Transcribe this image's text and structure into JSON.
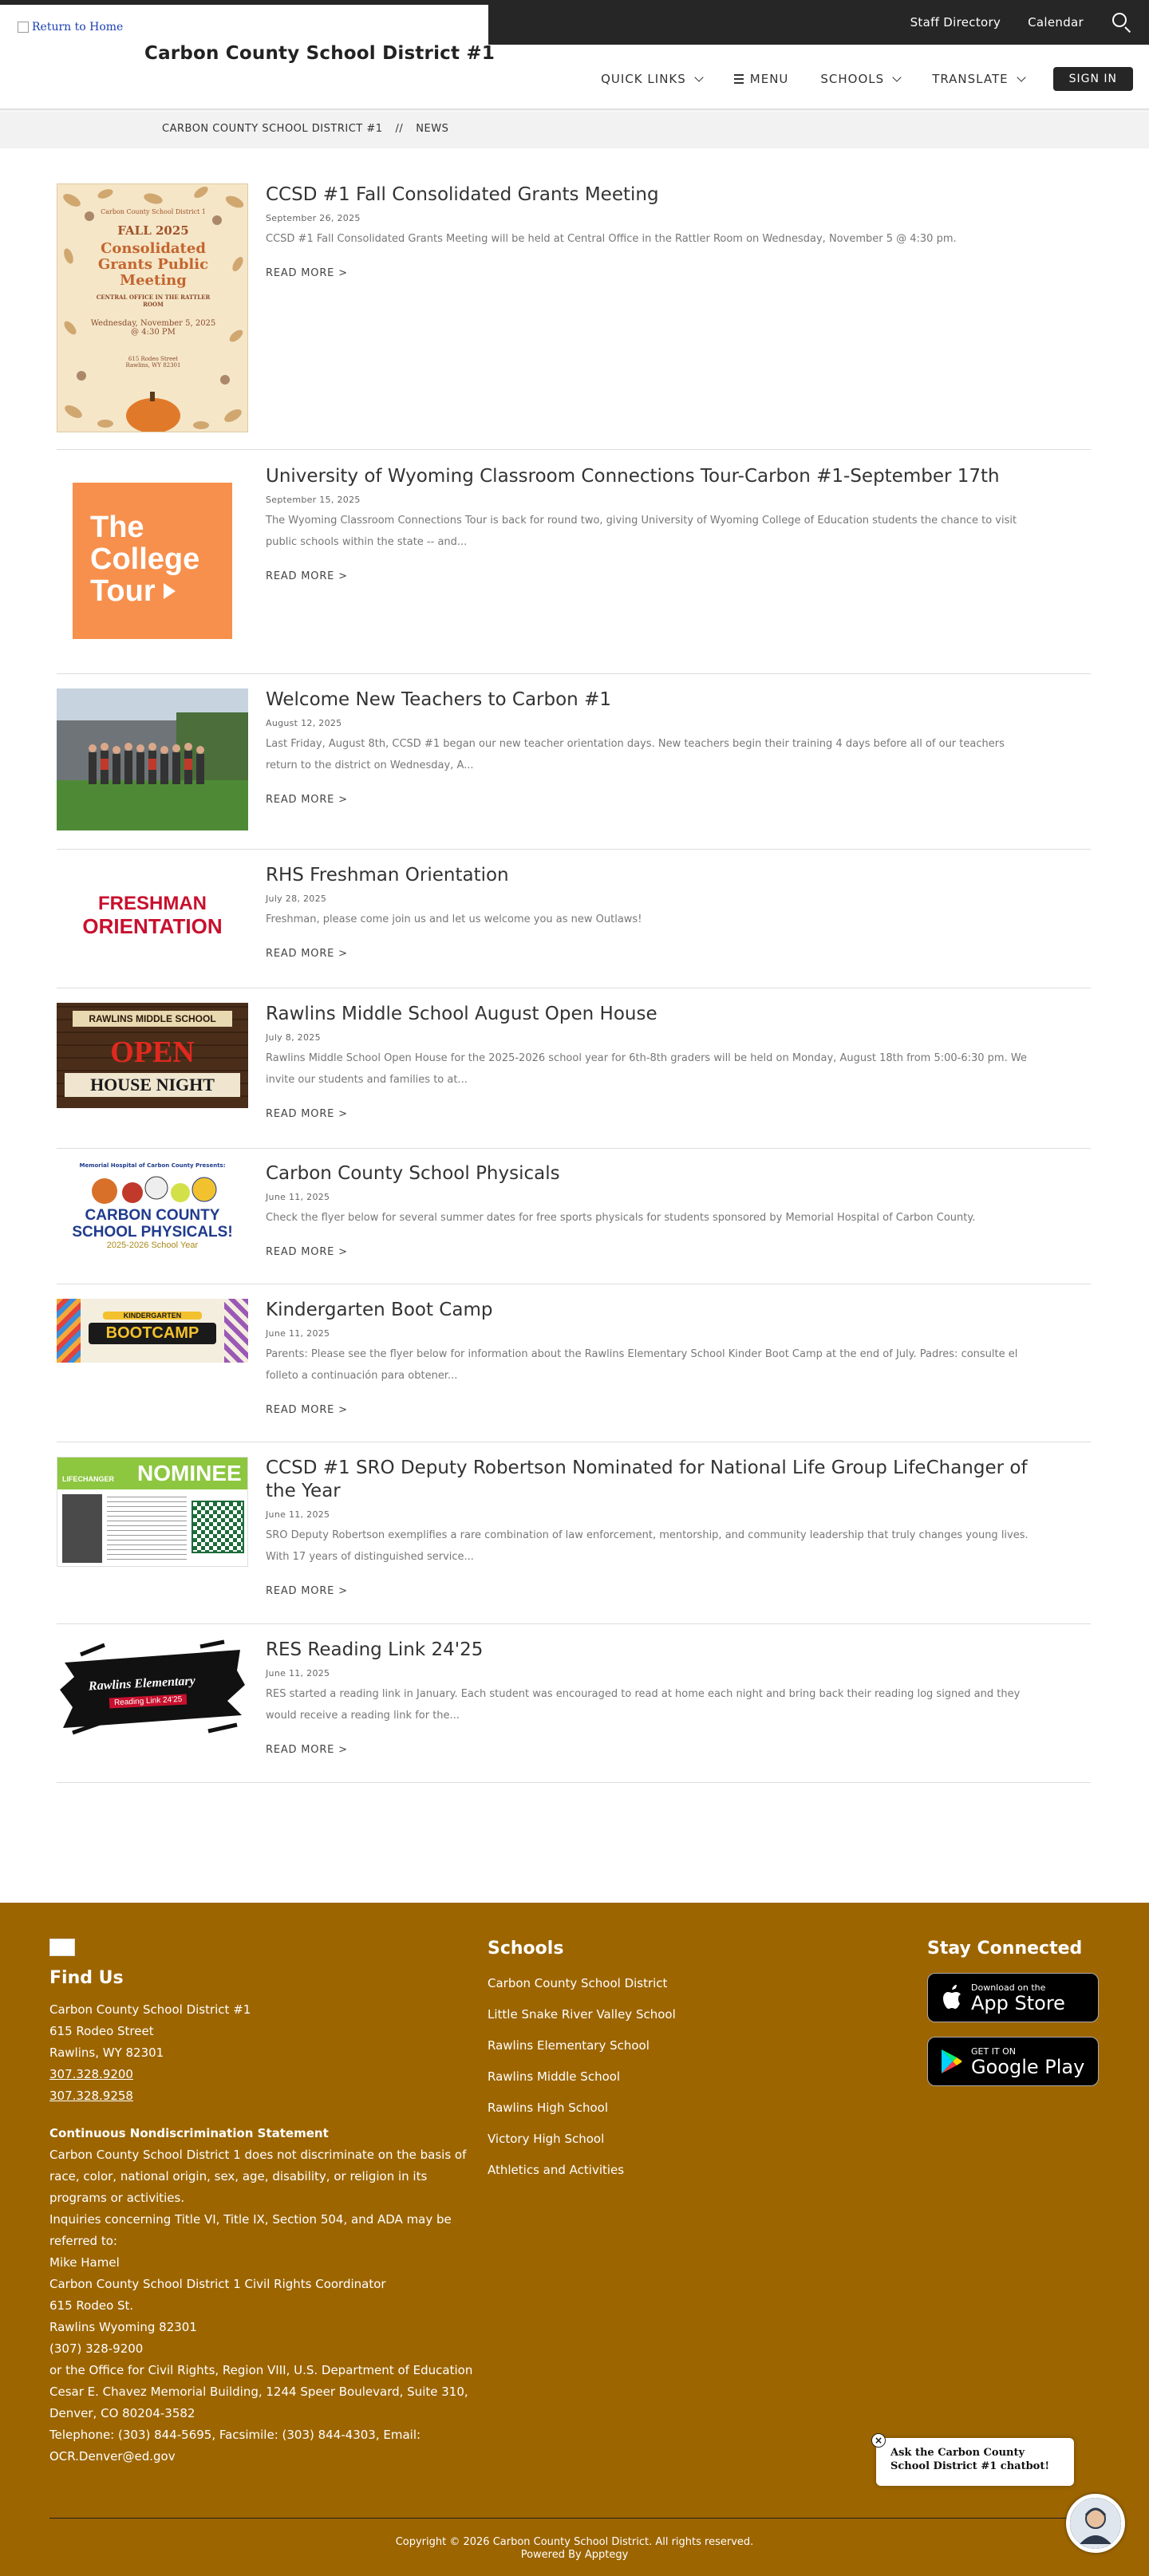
{
  "header": {
    "utility_links": [
      "Staff Directory",
      "Calendar"
    ],
    "logo_alt": "Return to Home",
    "site_title": "Carbon County School District #1",
    "nav": {
      "quick_links": "QUICK LINKS",
      "menu": "MENU",
      "schools": "SCHOOLS",
      "translate": "TRANSLATE",
      "sign_in": "SIGN IN"
    }
  },
  "breadcrumb": {
    "items": [
      "CARBON COUNTY SCHOOL DISTRICT #1",
      "//",
      "NEWS"
    ]
  },
  "articles": [
    {
      "title": "CCSD #1 Fall Consolidated Grants Meeting",
      "date": "September 26, 2025",
      "summary": "CCSD #1 Fall Consolidated Grants Meeting will be held at Central Office in the Rattler Room on Wednesday, November 5 @ 4:30 pm.",
      "read_more": "READ MORE",
      "image": {
        "line1": "Carbon County School District 1",
        "line2": "FALL 2025",
        "line3": "Consolidated Grants Public Meeting",
        "line4": "CENTRAL OFFICE IN THE RATTLER ROOM",
        "line5": "Wednesday, November 5, 2025",
        "line6": "@ 4:30 PM",
        "line7": "615 Rodeo Street",
        "line8": "Rawlins, WY 82301"
      }
    },
    {
      "title": "University of Wyoming Classroom Connections Tour-Carbon #1-September 17th",
      "date": "September 15, 2025",
      "summary": "The Wyoming Classroom Connections Tour is back for round two, giving University of Wyoming College of Education students the chance to visit public schools within the state -- and...",
      "read_more": "READ MORE",
      "image": {
        "line1": "The",
        "line2": "College",
        "line3": "Tour"
      }
    },
    {
      "title": "Welcome New Teachers to Carbon #1",
      "date": "August 12, 2025",
      "summary": "Last Friday, August 8th, CCSD #1 began our new teacher orientation days. New teachers begin their training 4 days before all of our teachers return to the district on Wednesday, A...",
      "read_more": "READ MORE"
    },
    {
      "title": "RHS Freshman Orientation",
      "date": "July 28, 2025",
      "summary": "Freshman, please come join us and let us welcome you as new Outlaws!",
      "read_more": "READ MORE",
      "image": {
        "line1": "FRESHMAN",
        "line2": "ORIENTATION"
      }
    },
    {
      "title": "Rawlins Middle School August Open House",
      "date": "July 8, 2025",
      "summary": "Rawlins Middle School Open House for the 2025-2026 school year for 6th-8th graders will be held on Monday, August 18th from 5:00-6:30 pm. We invite our students and families to at...",
      "read_more": "READ MORE",
      "image": {
        "line1": "RAWLINS MIDDLE SCHOOL",
        "line2": "OPEN",
        "line3": "HOUSE NIGHT"
      }
    },
    {
      "title": "Carbon County School Physicals",
      "date": "June 11, 2025",
      "summary": "Check the flyer below for several summer dates for free sports physicals for students sponsored by Memorial Hospital of Carbon County.",
      "read_more": "READ MORE",
      "image": {
        "line1": "Memorial Hospital of Carbon County Presents:",
        "line2": "CARBON COUNTY",
        "line3": "SCHOOL PHYSICALS!",
        "line4": "2025-2026 School Year"
      }
    },
    {
      "title": "Kindergarten Boot Camp",
      "date": "June 11, 2025",
      "summary": "Parents: Please see the flyer below for information about the Rawlins Elementary School Kinder Boot Camp at the end of July. Padres: consulte el folleto a continuación para obtener...",
      "read_more": "READ MORE",
      "image": {
        "line1": "KINDERGARTEN",
        "line2": "BOOTCAMP"
      }
    },
    {
      "title": "CCSD #1 SRO Deputy Robertson Nominated for National Life Group LifeChanger of the Year",
      "date": "June 11, 2025",
      "summary": "SRO Deputy Robertson exemplifies a rare combination of law enforcement, mentorship, and community leadership that truly changes young lives. With 17 years of distinguished service...",
      "read_more": "READ MORE",
      "image": {
        "line1": "LIFECHANGER",
        "line2": "NOMINEE"
      }
    },
    {
      "title": "RES Reading Link 24'25",
      "date": "June 11, 2025",
      "summary": "RES started a reading link in January. Each student was encouraged to read at home each night and bring back their reading log signed and they would receive a reading link for the...",
      "read_more": "READ MORE",
      "image": {
        "line1": "Rawlins Elementary",
        "line2": "Reading Link 24'25"
      }
    }
  ],
  "footer": {
    "find_us": {
      "heading": "Find Us",
      "name": "Carbon County School District #1",
      "street": "615 Rodeo Street",
      "city": "Rawlins, WY 82301",
      "phone": "307.328.9200",
      "fax": "307.328.9258"
    },
    "nondiscrimination": {
      "heading": "Continuous Nondiscrimination Statement",
      "para1": "Carbon County School District 1 does not discriminate on the basis of race, color, national origin, sex, age, disability, or religion in its programs or activities.",
      "para2": "Inquiries concerning Title VI, Title IX, Section 504, and ADA may be referred to:",
      "contact_name": "Mike Hamel",
      "contact_title": "Carbon County School District 1 Civil Rights Coordinator",
      "contact_street": "615 Rodeo St.",
      "contact_city": "Rawlins Wyoming 82301",
      "contact_phone": "(307) 328-9200",
      "ocr_intro": "or the Office for Civil Rights, Region VIII, U.S. Department of Education",
      "ocr_address": "Cesar E. Chavez Memorial Building, 1244 Speer Boulevard, Suite 310, Denver, CO 80204-3582",
      "ocr_contact": "Telephone: (303) 844-5695, Facsimile: (303) 844-4303, Email: OCR.Denver@ed.gov"
    },
    "schools": {
      "heading": "Schools",
      "links": [
        "Carbon County School District",
        "Little Snake River Valley School",
        "Rawlins Elementary School",
        "Rawlins Middle School",
        "Rawlins High School",
        "Victory High School",
        "Athletics and Activities"
      ]
    },
    "stay_connected": {
      "heading": "Stay Connected",
      "app_store_small": "Download on the",
      "app_store_big": "App Store",
      "google_play_small": "GET IT ON",
      "google_play_big": "Google Play"
    },
    "copyright": "Copyright © 2026 Carbon County School District. All rights reserved.",
    "powered_by": "Powered By Apptegy"
  },
  "chatbot": {
    "prompt": "Ask the Carbon County School District #1 chatbot!",
    "close": "×"
  },
  "colors": {
    "header_dark": "#262626",
    "footer_gold": "#9c6500",
    "breadcrumb_bg": "#f2f2f2"
  },
  "icons": [
    "search-icon",
    "chevron-down-icon",
    "menu-icon",
    "apple-icon",
    "google-play-icon",
    "close-icon"
  ]
}
